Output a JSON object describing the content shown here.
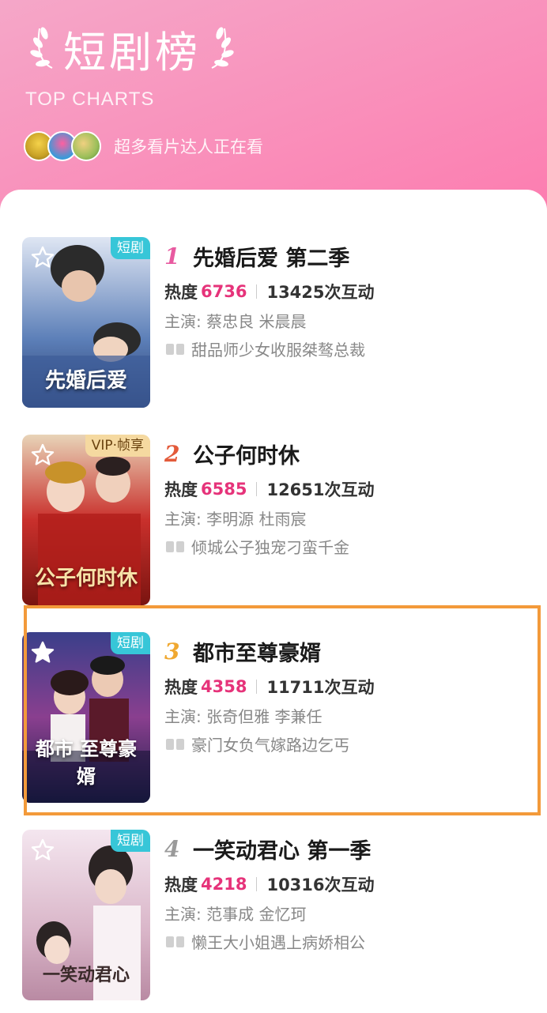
{
  "header": {
    "title": "短剧榜",
    "subtitle": "TOP CHARTS",
    "watchers_text": "超多看片达人正在看",
    "avatars": [
      "avatar-1",
      "avatar-2",
      "avatar-3"
    ]
  },
  "colors": {
    "accent": "#e6337a",
    "tag_default": "#37c6d8",
    "tag_vip": "#f5d9a0",
    "highlight_border": "#f39a3a"
  },
  "items": [
    {
      "rank": "1",
      "rank_color": "#e85aa0",
      "name": "先婚后爱 第二季",
      "heat_label": "热度",
      "heat_value": "6736",
      "interactions": "13425次互动",
      "cast": "主演: 蔡忠良 米晨晨",
      "desc": "甜品师少女收服桀骜总裁",
      "tag": "短剧",
      "tag_type": "default",
      "poster_title": "先婚后爱"
    },
    {
      "rank": "2",
      "rank_color": "#e35a3a",
      "name": "公子何时休",
      "heat_label": "热度",
      "heat_value": "6585",
      "interactions": "12651次互动",
      "cast": "主演: 李明源 杜雨宸",
      "desc": "倾城公子独宠刁蛮千金",
      "tag": "VIP·帧享",
      "tag_type": "vip",
      "poster_title": "公子何时休"
    },
    {
      "rank": "3",
      "rank_color": "#f0a830",
      "name": "都市至尊豪婿",
      "heat_label": "热度",
      "heat_value": "4358",
      "interactions": "11711次互动",
      "cast": "主演: 张奇但雅 李兼任",
      "desc": "豪门女负气嫁路边乞丐",
      "tag": "短剧",
      "tag_type": "default",
      "poster_title": "都市 至尊豪婿"
    },
    {
      "rank": "4",
      "rank_color": "#9a9a9a",
      "name": "一笑动君心 第一季",
      "heat_label": "热度",
      "heat_value": "4218",
      "interactions": "10316次互动",
      "cast": "主演: 范事成 金忆珂",
      "desc": "懒王大小姐遇上病娇相公",
      "tag": "短剧",
      "tag_type": "default",
      "poster_title": "一笑动君心"
    }
  ]
}
